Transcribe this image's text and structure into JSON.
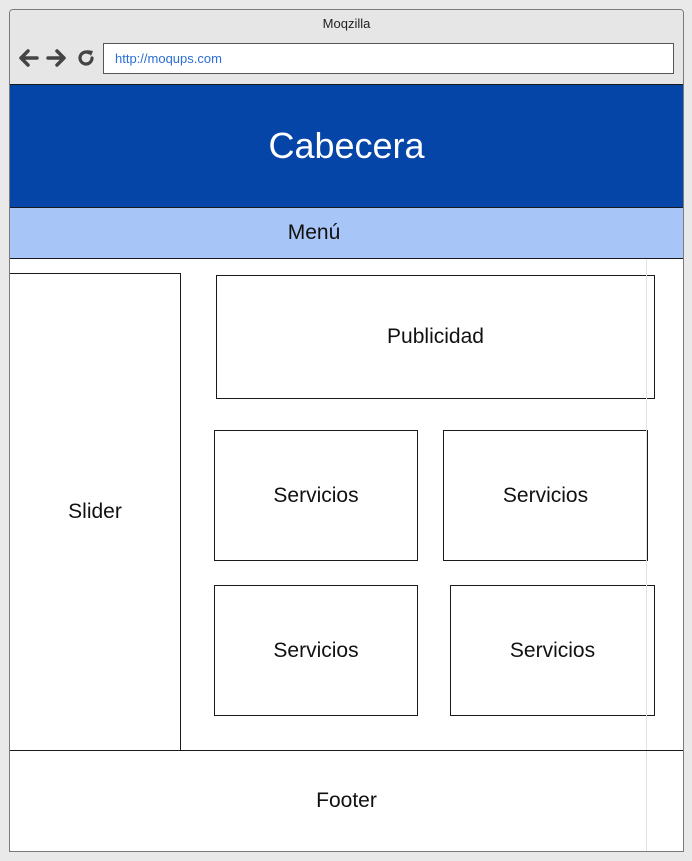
{
  "browser": {
    "title": "Moqzilla",
    "url": "http://moqups.com",
    "icons": [
      "arrow-left-icon",
      "arrow-right-icon",
      "reload-icon"
    ]
  },
  "page": {
    "header": "Cabecera",
    "menu": "Menú",
    "slider": "Slider",
    "ad": "Publicidad",
    "services": [
      "Servicios",
      "Servicios",
      "Servicios",
      "Servicios"
    ],
    "footer": "Footer"
  },
  "colors": {
    "header_bg": "#0645a8",
    "menu_bg": "#a8c5f7",
    "url_text": "#2a6fd3"
  }
}
